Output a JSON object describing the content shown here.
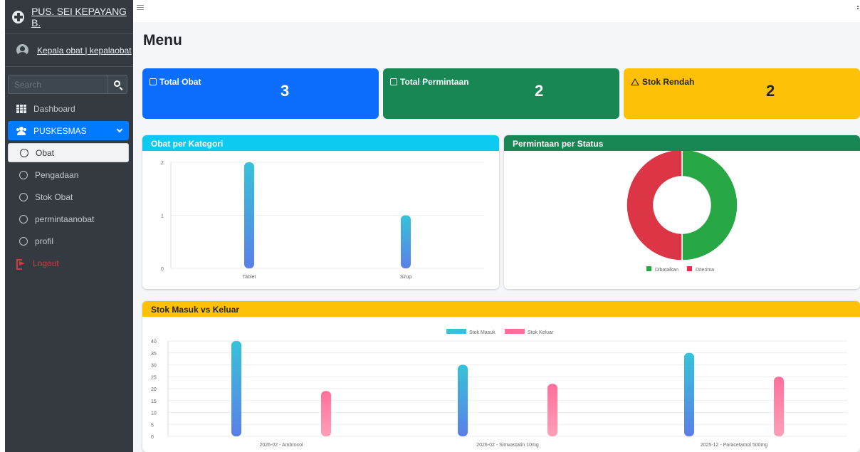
{
  "brand": {
    "name": "PUS. SEI KEPAYANG B."
  },
  "user": {
    "name": "Kepala obat | kepalaobat"
  },
  "search": {
    "placeholder": "Search"
  },
  "nav": {
    "dashboard": "Dashboard",
    "puskesmas": "PUSKESMAS",
    "items": [
      "Obat",
      "Pengadaan",
      "Stok Obat",
      "permintaanobat",
      "profil"
    ],
    "logout": "Logout"
  },
  "page": {
    "title": "Menu"
  },
  "stats": {
    "total_obat": {
      "label": "Total Obat",
      "value": "3"
    },
    "total_permintaan": {
      "label": "Total Permintaan",
      "value": "2"
    },
    "stok_rendah": {
      "label": "Stok Rendah",
      "value": "2"
    }
  },
  "colors": {
    "primary": "#0d6efd",
    "success": "#198754",
    "warning": "#ffc107",
    "info": "#0dcaf0",
    "danger": "#dc3545"
  },
  "icons": [
    "plus-circle-icon",
    "user-icon",
    "search-icon",
    "grid-icon",
    "users-icon",
    "chevron-down-icon",
    "circle-icon",
    "logout-icon",
    "pill-icon",
    "clipboard-icon",
    "warning-icon"
  ],
  "chart_data": [
    {
      "type": "bar",
      "title": "Obat per Kategori",
      "categories": [
        "Tablet",
        "Sirup"
      ],
      "values": [
        2,
        1
      ],
      "ylim": [
        0,
        2
      ],
      "yticks": [
        "0",
        "1",
        "2"
      ]
    },
    {
      "type": "pie",
      "title": "Permintaan per Status",
      "labels": [
        "Dibatalkan",
        "Diterima"
      ],
      "values": [
        1,
        1
      ],
      "colors": [
        "#28a745",
        "#dc3545"
      ],
      "legend": "bottom"
    },
    {
      "type": "bar",
      "title": "Stok Masuk vs Keluar",
      "categories": [
        "2026-02 - Ambroxol",
        "2026-02 - Simvastatin 10mg",
        "2025-12 - Paracetamol 500mg"
      ],
      "series": [
        {
          "name": "Stok Masuk",
          "values": [
            40,
            30,
            35
          ],
          "color": "#36c3d8"
        },
        {
          "name": "Stok Keluar",
          "values": [
            19,
            22,
            25
          ],
          "color": "#ff6f9c"
        }
      ],
      "ylim": [
        0,
        40
      ],
      "yticks": [
        "0",
        "5",
        "10",
        "15",
        "20",
        "25",
        "30",
        "35",
        "40"
      ],
      "legend": "top"
    }
  ]
}
